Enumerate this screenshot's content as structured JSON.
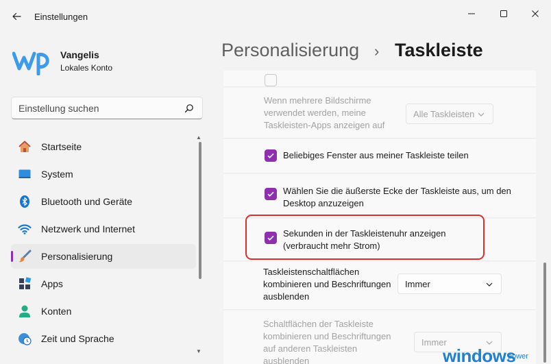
{
  "window": {
    "title": "Einstellungen",
    "controls": {
      "minimize": "minimize-icon",
      "maximize": "maximize-icon",
      "close": "close-icon"
    }
  },
  "profile": {
    "logo_text": "wp",
    "name": "Vangelis",
    "account_type": "Lokales Konto"
  },
  "search": {
    "placeholder": "Einstellung suchen"
  },
  "nav": {
    "items": [
      {
        "label": "Startseite",
        "icon": "home-icon",
        "active": false
      },
      {
        "label": "System",
        "icon": "monitor-icon",
        "active": false
      },
      {
        "label": "Bluetooth und Geräte",
        "icon": "bluetooth-icon",
        "active": false
      },
      {
        "label": "Netzwerk und Internet",
        "icon": "wifi-icon",
        "active": false
      },
      {
        "label": "Personalisierung",
        "icon": "brush-icon",
        "active": true
      },
      {
        "label": "Apps",
        "icon": "apps-icon",
        "active": false
      },
      {
        "label": "Konten",
        "icon": "person-icon",
        "active": false
      },
      {
        "label": "Zeit und Sprache",
        "icon": "clock-globe-icon",
        "active": false
      }
    ]
  },
  "breadcrumb": {
    "parent": "Personalisierung",
    "separator": "›",
    "current": "Taskleiste"
  },
  "settings": {
    "multi_monitor": {
      "label": "Wenn mehrere Bildschirme verwendet werden, meine Taskleisten-Apps anzeigen auf",
      "value": "Alle Taskleisten",
      "enabled": false
    },
    "share_window": {
      "label": "Beliebiges Fenster aus meiner Taskleiste teilen",
      "checked": true
    },
    "desktop_corner": {
      "label": "Wählen Sie die äußerste Ecke der Taskleiste aus, um den Desktop anzuzeigen",
      "checked": true
    },
    "show_seconds": {
      "label": "Sekunden in der Taskleistenuhr anzeigen (verbraucht mehr Strom)",
      "checked": true
    },
    "combine_buttons": {
      "label": "Taskleistenschaltflächen kombinieren und Beschriftungen ausblenden",
      "value": "Immer"
    },
    "combine_other": {
      "label": "Schaltflächen der Taskleiste kombinieren und Beschriftungen auf anderen Taskleisten ausblenden",
      "value": "Immer",
      "enabled": false
    }
  },
  "watermark": {
    "text": "windows",
    "suffix": "power"
  },
  "colors": {
    "accent": "#8e2fb0",
    "highlight_border": "#d6312e",
    "watermark": "#1f7fd4"
  }
}
